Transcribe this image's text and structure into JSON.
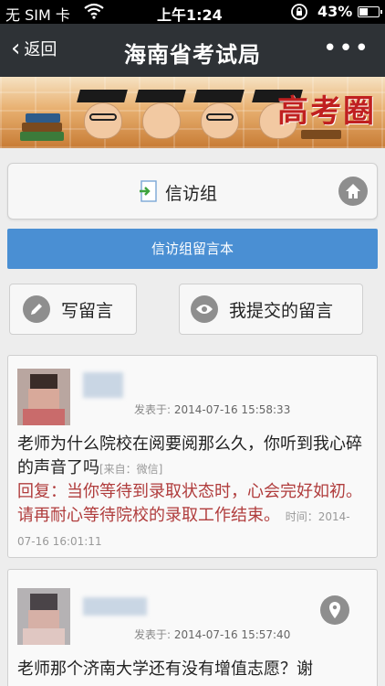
{
  "statusbar": {
    "carrier": "无 SIM 卡",
    "time": "上午1:24",
    "battery": "43%",
    "battery_level": 0.43
  },
  "navbar": {
    "back_label": "返回",
    "title": "海南省考试局",
    "more_label": "•••"
  },
  "banner": {
    "text": "高考圈"
  },
  "group_panel": {
    "title": "信访组"
  },
  "guestbook_bar": {
    "label": "信访组留言本"
  },
  "actions": {
    "write_label": "写留言",
    "mine_label": "我提交的留言"
  },
  "messages": [
    {
      "meta_prefix": "发表于:",
      "date": "2014-07-16 15:58:33",
      "text": "老师为什么院校在阅要阅那么久，你听到我心碎的声音了吗",
      "source": "[来自：微信]",
      "reply": "回复：当你等待到录取状态时，心会完好如初。请再耐心等待院校的录取工作结束。",
      "reply_time_label": "时间：",
      "reply_time": "2014-07-16 16:01:11"
    },
    {
      "meta_prefix": "发表于:",
      "date": "2014-07-16 15:57:40",
      "text": "老师那个济南大学还有没有增值志愿？谢"
    }
  ]
}
